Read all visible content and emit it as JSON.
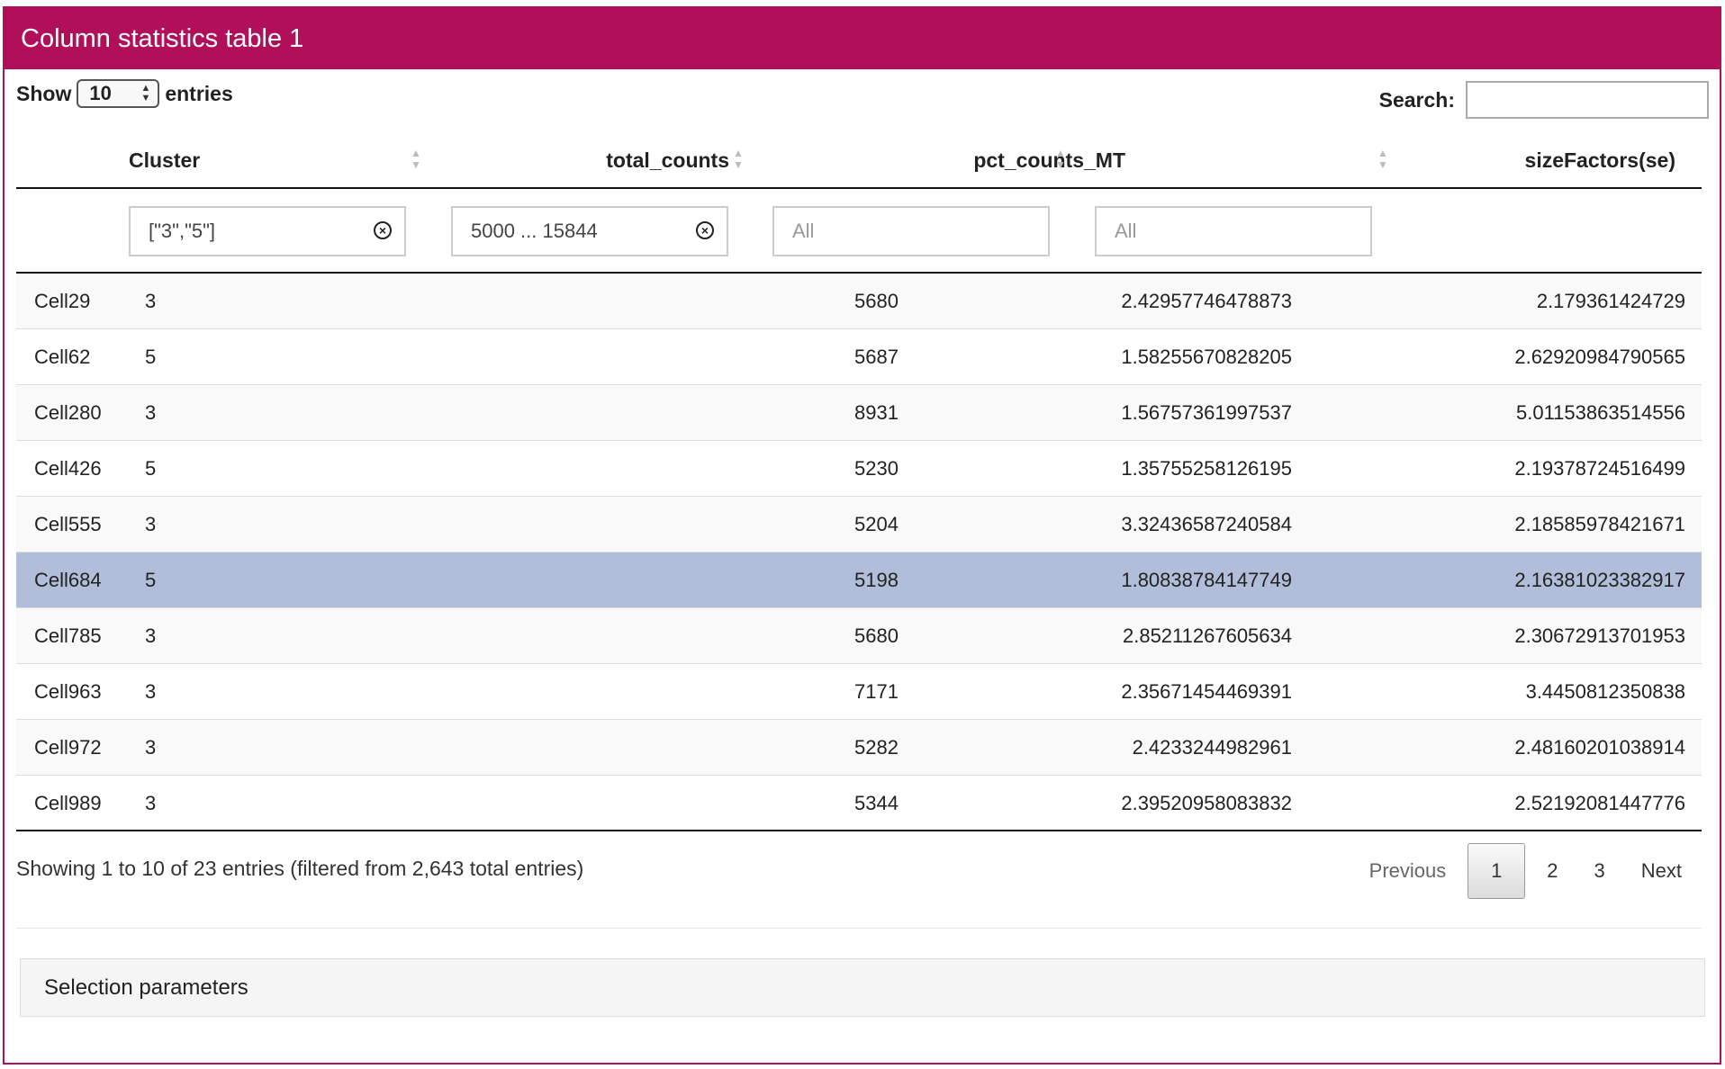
{
  "panel": {
    "title": "Column statistics table 1",
    "accent_color": "#b20f5a"
  },
  "length_control": {
    "show_label": "Show",
    "selected": "10",
    "entries_label": "entries"
  },
  "search": {
    "label": "Search:",
    "value": ""
  },
  "columns": [
    "",
    "Cluster",
    "total_counts",
    "pct_counts_MT",
    "sizeFactors(se)"
  ],
  "filters": {
    "cluster": "[\"3\",\"5\"]",
    "total_counts": "5000 ... 15844",
    "pct_counts_MT_placeholder": "All",
    "size_factors_placeholder": "All"
  },
  "rows": [
    {
      "name": "Cell29",
      "cluster": "3",
      "total_counts": "5680",
      "pct": "2.42957746478873",
      "sf": "2.179361424729"
    },
    {
      "name": "Cell62",
      "cluster": "5",
      "total_counts": "5687",
      "pct": "1.58255670828205",
      "sf": "2.62920984790565"
    },
    {
      "name": "Cell280",
      "cluster": "3",
      "total_counts": "8931",
      "pct": "1.56757361997537",
      "sf": "5.01153863514556"
    },
    {
      "name": "Cell426",
      "cluster": "5",
      "total_counts": "5230",
      "pct": "1.35755258126195",
      "sf": "2.19378724516499"
    },
    {
      "name": "Cell555",
      "cluster": "3",
      "total_counts": "5204",
      "pct": "3.32436587240584",
      "sf": "2.18585978421671"
    },
    {
      "name": "Cell684",
      "cluster": "5",
      "total_counts": "5198",
      "pct": "1.80838784147749",
      "sf": "2.16381023382917",
      "selected": true
    },
    {
      "name": "Cell785",
      "cluster": "3",
      "total_counts": "5680",
      "pct": "2.85211267605634",
      "sf": "2.30672913701953"
    },
    {
      "name": "Cell963",
      "cluster": "3",
      "total_counts": "7171",
      "pct": "2.35671454469391",
      "sf": "3.4450812350838"
    },
    {
      "name": "Cell972",
      "cluster": "3",
      "total_counts": "5282",
      "pct": "2.4233244982961",
      "sf": "2.48160201038914"
    },
    {
      "name": "Cell989",
      "cluster": "3",
      "total_counts": "5344",
      "pct": "2.39520958083832",
      "sf": "2.52192081447776"
    }
  ],
  "info": "Showing 1 to 10 of 23 entries (filtered from 2,643 total entries)",
  "pagination": {
    "previous": "Previous",
    "pages": [
      "1",
      "2",
      "3"
    ],
    "current": "1",
    "next": "Next"
  },
  "selection_params": {
    "label": "Selection parameters"
  },
  "colors": {
    "selected_row": "#b0bed9",
    "odd_row": "#f9f9f9"
  }
}
